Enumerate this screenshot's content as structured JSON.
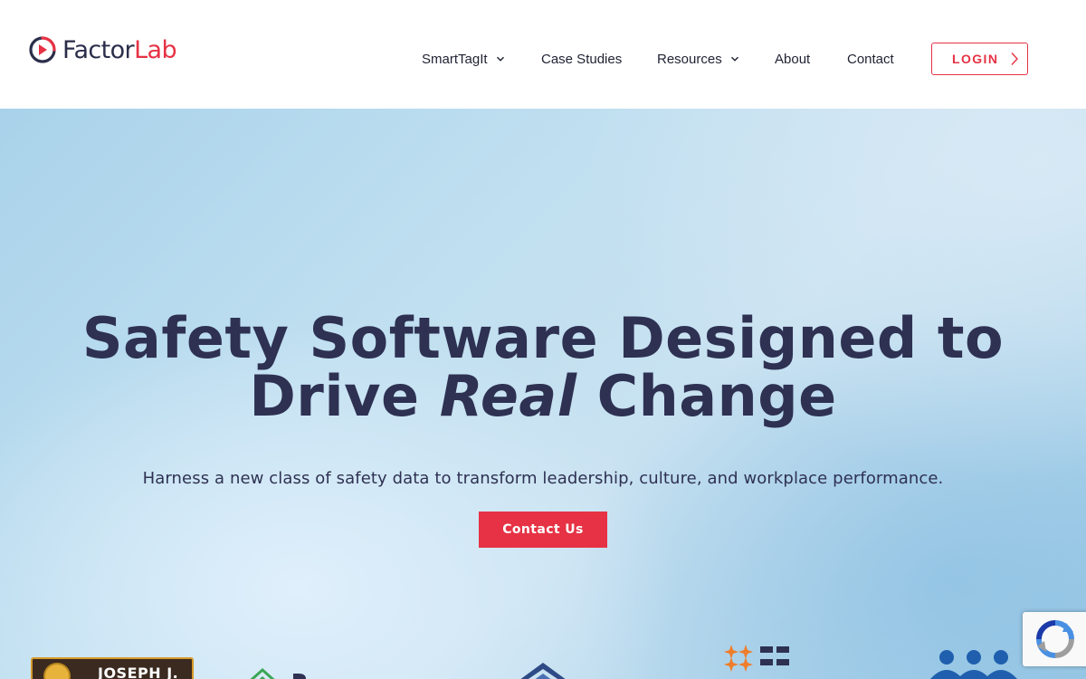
{
  "brand": {
    "name_part1": "Factor",
    "name_part2": "Lab",
    "colors": {
      "primary": "#e63244",
      "dark": "#2b2e4a"
    }
  },
  "nav": {
    "items": [
      {
        "label": "SmartTagIt",
        "has_dropdown": true
      },
      {
        "label": "Case Studies",
        "has_dropdown": false
      },
      {
        "label": "Resources",
        "has_dropdown": true
      },
      {
        "label": "About",
        "has_dropdown": false
      },
      {
        "label": "Contact",
        "has_dropdown": false
      }
    ],
    "login_label": "LOGIN"
  },
  "hero": {
    "title_line1": "Safety Software Designed to",
    "title_line2_start": "Drive",
    "title_line2_emphasis": "Real",
    "title_line2_end": "Change",
    "subtitle": "Harness a new class of safety data to transform leadership, culture, and workplace performance.",
    "cta_label": "Contact Us"
  },
  "partners": {
    "logo1_text": "JOSEPH J."
  },
  "icons": {
    "logo": "factorlab-logo-icon",
    "dropdown": "chevron-down-icon",
    "login": "chevron-right-icon",
    "captcha": "recaptcha-icon"
  }
}
